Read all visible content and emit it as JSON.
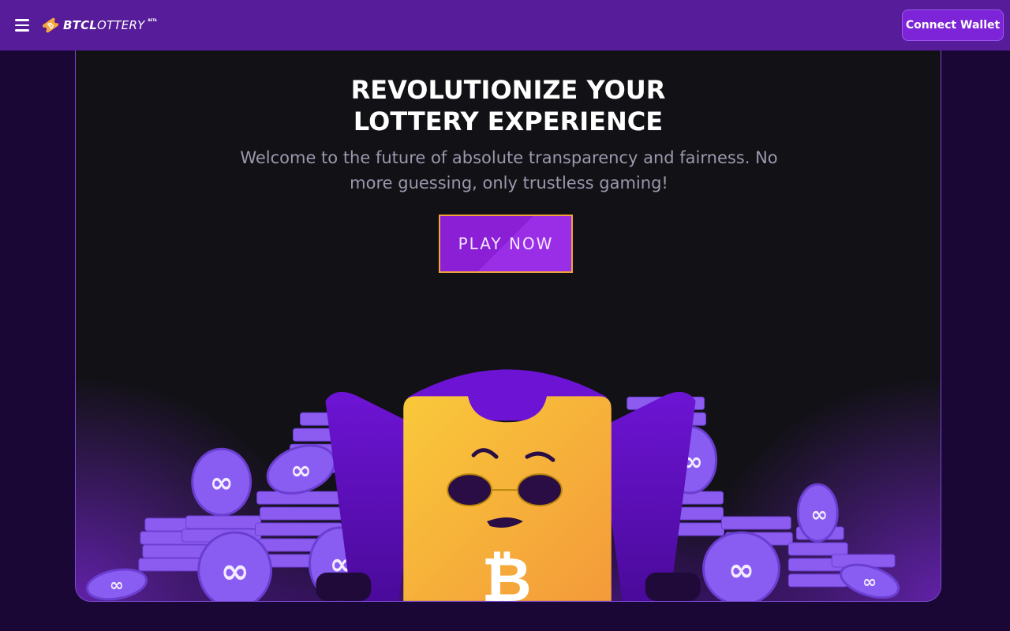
{
  "navbar": {
    "logo_bold": "BTCL",
    "logo_light": "OTTERY",
    "logo_beta": "BETA",
    "connect_label": "Connect Wallet"
  },
  "hero": {
    "title_line1": "REVOLUTIONIZE YOUR",
    "title_line2": "LOTTERY EXPERIENCE",
    "subtitle": "Welcome to the future of absolute transparency and fairness. No more guessing, only trustless gaming!",
    "play_label": "PLAY NOW"
  },
  "colors": {
    "navbar": "#561c9a",
    "background": "#1a0735",
    "accent": "#8a1fd6",
    "ticket": "#f6a83c",
    "coin": "#8b5cf6"
  },
  "icons": {
    "menu": "hamburger-menu-icon",
    "logo": "ticket-logo-icon",
    "coin": "polygon-coin-icon",
    "currency": "bitcoin-icon"
  }
}
